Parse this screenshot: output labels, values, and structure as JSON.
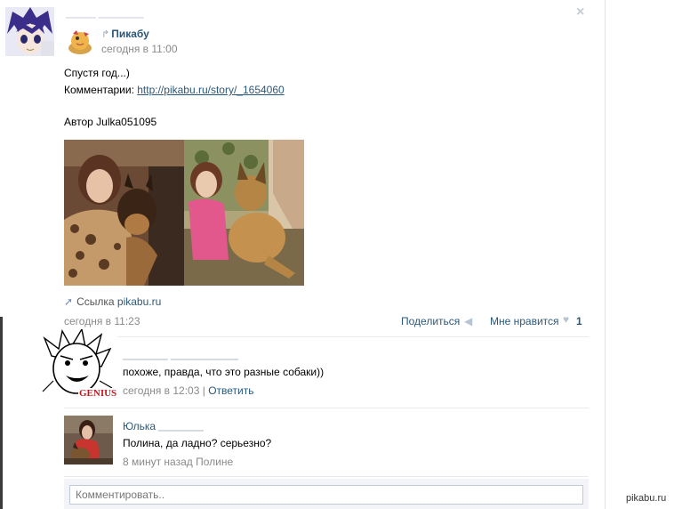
{
  "post": {
    "close_icon": "×",
    "group_repost_icon": "repost-arrow-icon",
    "group_name": "Пикабу",
    "group_time": "сегодня в 11:00",
    "text_line1": "Спустя год...)",
    "comments_label": "Комментарии: ",
    "comments_link": "http://pikabu.ru/story/_1654060",
    "author_line": "Автор Julka051095",
    "link_label": "Ссылка ",
    "link_source": "pikabu.ru",
    "date": "сегодня в 11:23",
    "share_label": "Поделиться",
    "like_label": "Мне нравится",
    "like_count": "1"
  },
  "comments": [
    {
      "text": "похоже, правда, что это разные собаки))",
      "time": "сегодня в 12:03",
      "separator": " | ",
      "reply_label": "Ответить",
      "avatar_caption": "GENIUS"
    },
    {
      "name": "Юлька",
      "text": "Полина, да ладно? серьезно?",
      "meta": "8 минут назад Полине"
    }
  ],
  "composer": {
    "placeholder": "Комментировать.."
  },
  "watermark": "pikabu.ru",
  "colors": {
    "link": "#2b587a",
    "muted": "#8a8a8a",
    "divider": "#e7ebf0"
  }
}
